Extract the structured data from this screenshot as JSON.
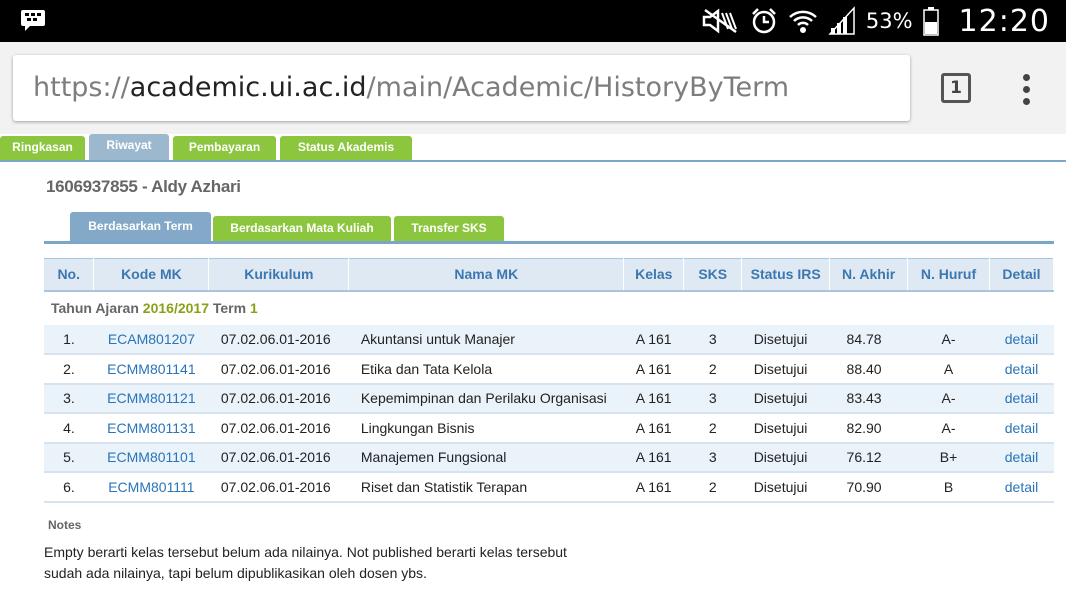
{
  "statusbar": {
    "battery": "53%",
    "time": "12:20",
    "icons": [
      "bbm-icon",
      "mute-icon",
      "alarm-icon",
      "wifi-icon",
      "signal-icon",
      "battery-icon"
    ]
  },
  "browser": {
    "url_scheme": "https://",
    "url_host": "academic.ui.ac.id",
    "url_path": "/main/Academic/HistoryByTerm",
    "tab_count": "1"
  },
  "main_tabs": [
    "Ringkasan",
    "Riwayat",
    "Pembayaran",
    "Status Akademis"
  ],
  "student": "1606937855 - Aldy Azhari",
  "sub_tabs": [
    "Berdasarkan Term",
    "Berdasarkan Mata Kuliah",
    "Transfer SKS"
  ],
  "table": {
    "headers": [
      "No.",
      "Kode MK",
      "Kurikulum",
      "Nama MK",
      "Kelas",
      "SKS",
      "Status IRS",
      "N. Akhir",
      "N. Huruf",
      "Detail"
    ],
    "term": {
      "prefix": "Tahun Ajaran",
      "year": "2016/2017",
      "term_label": "Term",
      "term_no": "1"
    },
    "rows": [
      [
        "1.",
        "ECAM801207",
        "07.02.06.01-2016",
        "Akuntansi untuk Manajer",
        "A 161",
        "3",
        "Disetujui",
        "84.78",
        "A-",
        "detail"
      ],
      [
        "2.",
        "ECMM801141",
        "07.02.06.01-2016",
        "Etika dan Tata Kelola",
        "A 161",
        "2",
        "Disetujui",
        "88.40",
        "A",
        "detail"
      ],
      [
        "3.",
        "ECMM801121",
        "07.02.06.01-2016",
        "Kepemimpinan dan Perilaku Organisasi",
        "A 161",
        "3",
        "Disetujui",
        "83.43",
        "A-",
        "detail"
      ],
      [
        "4.",
        "ECMM801131",
        "07.02.06.01-2016",
        "Lingkungan Bisnis",
        "A 161",
        "2",
        "Disetujui",
        "82.90",
        "A-",
        "detail"
      ],
      [
        "5.",
        "ECMM801101",
        "07.02.06.01-2016",
        "Manajemen Fungsional",
        "A 161",
        "3",
        "Disetujui",
        "76.12",
        "B+",
        "detail"
      ],
      [
        "6.",
        "ECMM801111",
        "07.02.06.01-2016",
        "Riset dan Statistik Terapan",
        "A 161",
        "2",
        "Disetujui",
        "70.90",
        "B",
        "detail"
      ]
    ]
  },
  "notes": {
    "title": "Notes",
    "line1": "Empty berarti kelas tersebut belum ada nilainya. Not published berarti kelas tersebut",
    "line2": "sudah ada nilainya, tapi belum dipublikasikan oleh dosen ybs."
  },
  "colors": {
    "tab_green": "#8cc63f",
    "tab_active": "#9cb8cf",
    "link": "#2a74b8",
    "header_text": "#3d77b0",
    "row_alt": "#eaf2fa"
  }
}
